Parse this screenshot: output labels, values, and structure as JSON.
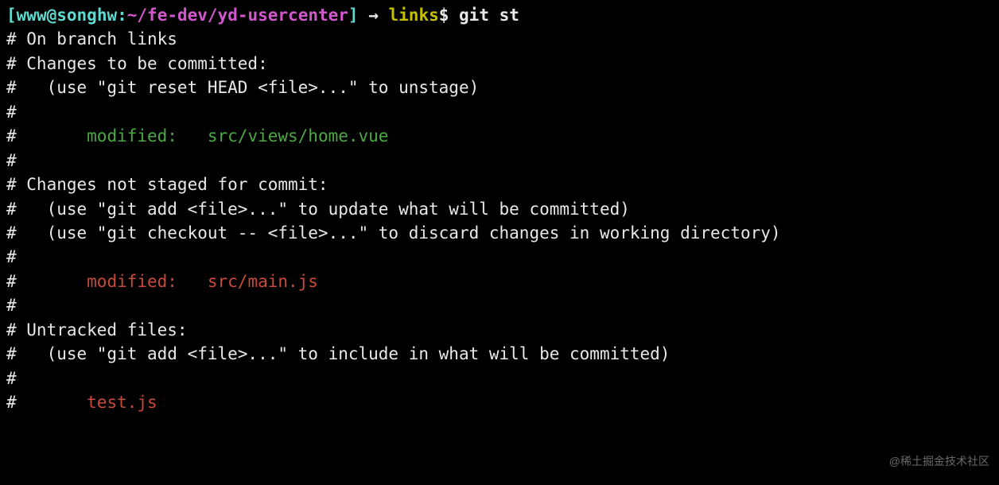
{
  "prompt": {
    "l_bracket": "[",
    "user": "www",
    "at": "@",
    "host": "songhw",
    "colon": ":",
    "path": "~/fe-dev/yd-usercenter",
    "r_bracket": "]",
    "arrow": " → ",
    "branch": "links",
    "dollar": "$ ",
    "command": "git st"
  },
  "out": {
    "l01": "# On branch links",
    "l02": "# Changes to be committed:",
    "l03": "#   (use \"git reset HEAD <file>...\" to unstage)",
    "l04": "#",
    "l05_hash": "#",
    "l05_mod": "       modified:   src/views/home.vue",
    "l06": "#",
    "l07": "# Changes not staged for commit:",
    "l08": "#   (use \"git add <file>...\" to update what will be committed)",
    "l09": "#   (use \"git checkout -- <file>...\" to discard changes in working directory)",
    "l10": "#",
    "l11_hash": "#",
    "l11_mod": "       modified:   src/main.js",
    "l12": "#",
    "l13": "# Untracked files:",
    "l14": "#   (use \"git add <file>...\" to include in what will be committed)",
    "l15": "#",
    "l16_hash": "#",
    "l16_file": "       test.js"
  },
  "watermark": "@稀土掘金技术社区"
}
